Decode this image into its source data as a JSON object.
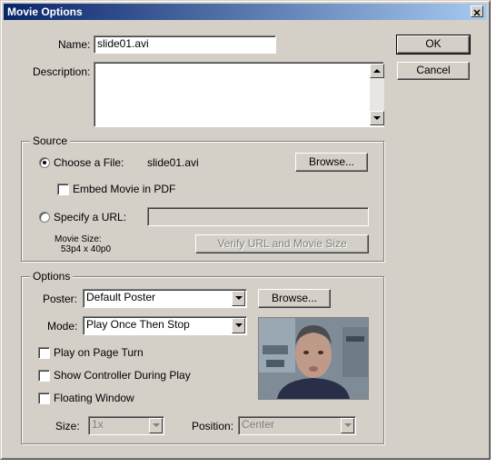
{
  "window": {
    "title": "Movie Options"
  },
  "name": {
    "label": "Name:",
    "value": "slide01.avi"
  },
  "description": {
    "label": "Description:",
    "value": ""
  },
  "buttons": {
    "ok": "OK",
    "cancel": "Cancel"
  },
  "source": {
    "title": "Source",
    "choose_file_label": "Choose a File:",
    "choose_file_selected": true,
    "file_name": "slide01.avi",
    "browse": "Browse...",
    "embed_label": "Embed Movie in PDF",
    "embed_checked": false,
    "url_label": "Specify a URL:",
    "url_value": "",
    "movie_size_label": "Movie Size:",
    "movie_size_value": "53p4 x 40p0",
    "verify_button": "Verify URL and Movie Size"
  },
  "options": {
    "title": "Options",
    "poster_label": "Poster:",
    "poster_value": "Default Poster",
    "browse": "Browse...",
    "mode_label": "Mode:",
    "mode_value": "Play Once Then Stop",
    "play_on_turn": "Play on Page Turn",
    "show_controller": "Show Controller During Play",
    "floating_window": "Floating Window",
    "size_label": "Size:",
    "size_value": "1x",
    "position_label": "Position:",
    "position_value": "Center"
  },
  "colors": {
    "title_bar_start": "#0a246a",
    "title_bar_end": "#a6caf0",
    "dialog_bg": "#d4d0c8"
  }
}
